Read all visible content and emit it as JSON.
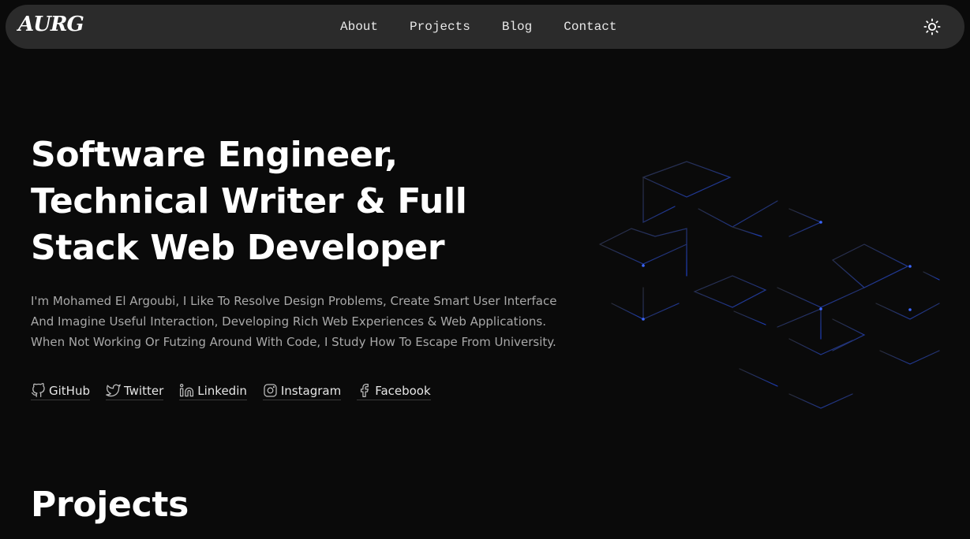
{
  "header": {
    "logo": "AURG",
    "nav": [
      {
        "label": "About"
      },
      {
        "label": "Projects"
      },
      {
        "label": "Blog"
      },
      {
        "label": "Contact"
      }
    ],
    "theme_icon": "sun-icon"
  },
  "hero": {
    "title": "Software Engineer, Technical Writer & Full Stack Web Developer",
    "description": "I'm Mohamed El Argoubi, I Like To Resolve Design Problems, Create Smart User Interface And Imagine Useful Interaction, Developing Rich Web Experiences & Web Applications. When Not Working Or Futzing Around With Code, I Study How To Escape From University.",
    "socials": [
      {
        "label": "GitHub",
        "icon": "github-icon"
      },
      {
        "label": "Twitter",
        "icon": "twitter-icon"
      },
      {
        "label": "Linkedin",
        "icon": "linkedin-icon"
      },
      {
        "label": "Instagram",
        "icon": "instagram-icon"
      },
      {
        "label": "Facebook",
        "icon": "facebook-icon"
      }
    ]
  },
  "projects": {
    "title": "Projects"
  },
  "colors": {
    "background": "#0a0a0a",
    "navbar": "#2b2b2b",
    "text": "#ffffff",
    "muted_text": "#a8a8a8",
    "accent": "#2f5bff"
  }
}
